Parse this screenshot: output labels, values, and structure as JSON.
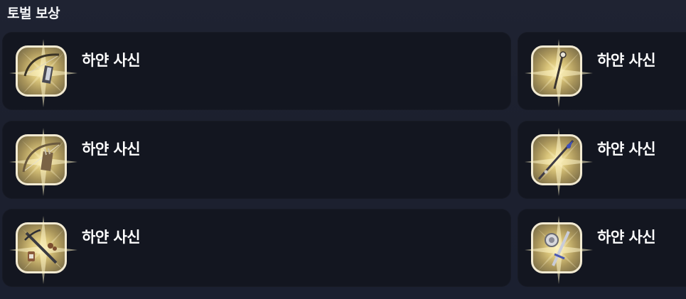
{
  "section": {
    "title": "토벌 보상"
  },
  "rewards": [
    {
      "name": "하얀 사신",
      "icon": "bow-quiver-icon"
    },
    {
      "name": "하얀 사신",
      "icon": "staff-icon"
    },
    {
      "name": "하얀 사신",
      "icon": "longbow-arrows-icon"
    },
    {
      "name": "하얀 사신",
      "icon": "spear-icon"
    },
    {
      "name": "하얀 사신",
      "icon": "crossbow-set-icon"
    },
    {
      "name": "하얀 사신",
      "icon": "sword-shield-icon"
    }
  ],
  "colors": {
    "background": "#1f2332",
    "card": "#131620",
    "icon_border": "#f2ead2",
    "icon_glow": "#f6e9a6"
  }
}
